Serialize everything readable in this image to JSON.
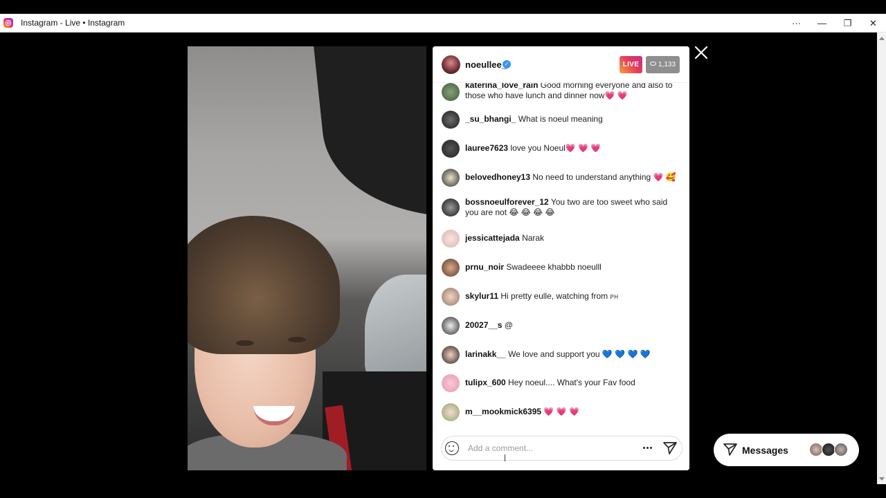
{
  "window": {
    "title": "Instagram - Live • Instagram",
    "controls": {
      "more": "···",
      "minimize": "—",
      "restore": "❐",
      "close": "✕"
    }
  },
  "live": {
    "host": "noeullee_",
    "badge": "LIVE",
    "viewers": "1,133",
    "comment_placeholder": "Add a comment..."
  },
  "comments": [
    {
      "user": "katerina_love_rain",
      "text": "Good morning everyone and also to those who have lunch and dinner now💗 💗"
    },
    {
      "user": "_su_bhangi_",
      "text": "What is noeul meaning"
    },
    {
      "user": "lauree7623",
      "text": "love you Noeul💗 💗 💗"
    },
    {
      "user": "belovedhoney13",
      "text": "No need to understand anything 💗 🥰"
    },
    {
      "user": "bossnoeulforever_12",
      "text": "You two are too sweet who said you are not 😂 😂 😂 😂"
    },
    {
      "user": "jessicattejada",
      "text": "Narak"
    },
    {
      "user": "prnu_noir",
      "text": "Swadeeee khabbb noeulll"
    },
    {
      "user": "skylur11",
      "text": "Hi pretty eulle, watching from",
      "suffix": "PH"
    },
    {
      "user": "20027__s",
      "text": "@"
    },
    {
      "user": "larinakk__",
      "text": "We love and support you 💙 💙 💙 💙"
    },
    {
      "user": "tulipx_600",
      "text": "Hey noeul.... What's your Fav food"
    },
    {
      "user": "m__mookmick6395",
      "text": "💗 💗 💗"
    }
  ],
  "messages_button": {
    "label": "Messages"
  },
  "icons": {
    "app": "instagram-icon",
    "close": "close-icon",
    "emoji": "smile-icon",
    "more": "more-icon",
    "send": "send-icon",
    "eye": "eye-icon",
    "verified": "verified-icon"
  },
  "colors": {
    "live_gradient_start": "#f6a13a",
    "live_gradient_end": "#c2338f",
    "verified_blue": "#3897f0",
    "viewer_badge_gray": "#8e8e8e"
  }
}
